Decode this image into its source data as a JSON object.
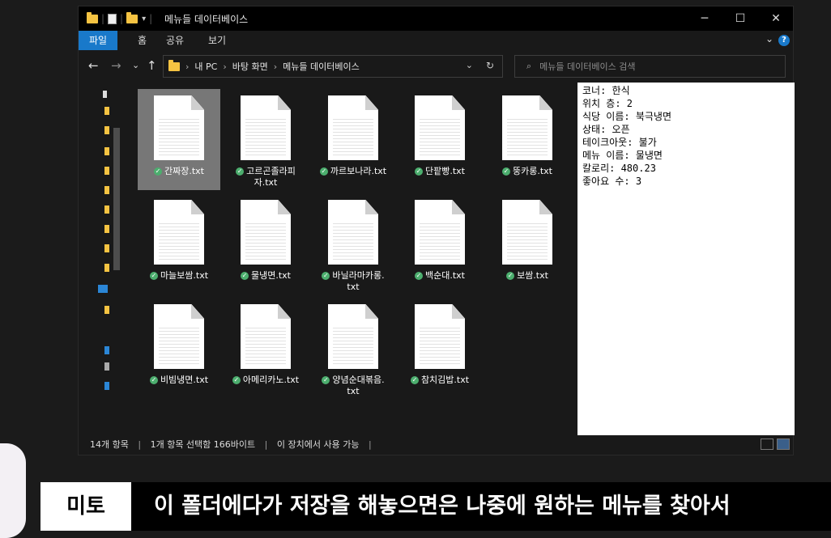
{
  "window": {
    "title": "메뉴들 데이터베이스",
    "controls": {
      "minimize": "─",
      "maximize": "☐",
      "close": "✕"
    }
  },
  "ribbon": {
    "tabs": [
      "파일",
      "홈",
      "공유",
      "보기"
    ],
    "expand": "⌄",
    "help": "?"
  },
  "address": {
    "back": "←",
    "forward": "→",
    "recent": "⌄",
    "up": "↑",
    "crumbs": [
      "내 PC",
      "바탕 화면",
      "메뉴들 데이터베이스"
    ],
    "dropdown": "⌄",
    "refresh": "↻"
  },
  "search": {
    "icon": "⌕",
    "placeholder": "메뉴들 데이터베이스 검색"
  },
  "files": [
    {
      "line1": "간짜장.txt",
      "line2": ""
    },
    {
      "line1": "고르곤졸라피",
      "line2": "자.txt"
    },
    {
      "line1": "까르보나라.txt",
      "line2": ""
    },
    {
      "line1": "단팥빵.txt",
      "line2": ""
    },
    {
      "line1": "뚱카롱.txt",
      "line2": ""
    },
    {
      "line1": "마늘보쌈.txt",
      "line2": ""
    },
    {
      "line1": "물냉면.txt",
      "line2": ""
    },
    {
      "line1": "바닐라마카롱.",
      "line2": "txt"
    },
    {
      "line1": "백순대.txt",
      "line2": ""
    },
    {
      "line1": "보쌈.txt",
      "line2": ""
    },
    {
      "line1": "비빔냉면.txt",
      "line2": ""
    },
    {
      "line1": "아메리카노.txt",
      "line2": ""
    },
    {
      "line1": "양념순대볶음.",
      "line2": "txt"
    },
    {
      "line1": "참치김밥.txt",
      "line2": ""
    }
  ],
  "sync_icon": "✓",
  "preview": {
    "lines": [
      "코너: 한식",
      "위치 층: 2",
      "식당 이름: 북극냉면",
      "상태: 오픈",
      "테이크아웃: 불가",
      "메뉴 이름: 물냉면",
      "칼로리: 480.23",
      "좋아요 수: 3"
    ]
  },
  "status": {
    "count": "14개 항목",
    "selection": "1개 항목 선택함 166바이트",
    "availability": "이 장치에서 사용 가능",
    "divider": "|"
  },
  "caption": {
    "speaker": "미토",
    "text": "이 폴더에다가 저장을 해놓으면은 나중에 원하는 메뉴를 찾아서"
  },
  "colors": {
    "accent": "#1979ca",
    "folder": "#f5c342",
    "sync_green": "#4cae6e",
    "selected": "#777777"
  },
  "icons": [
    "folder-icon",
    "notepad-icon",
    "text-file-icon",
    "sync-check-icon",
    "search-icon",
    "help-icon"
  ]
}
